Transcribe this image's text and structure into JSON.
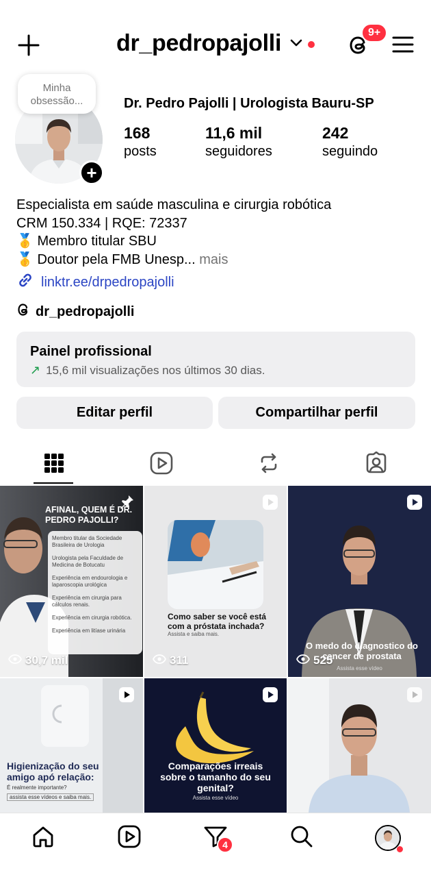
{
  "header": {
    "username": "dr_pedropajolli",
    "threads_badge": "9+"
  },
  "profile": {
    "note": "Minha obsessão...",
    "display_name": "Dr. Pedro Pajolli | Urologista Bauru-SP",
    "stats": [
      {
        "value": "168",
        "label": "posts"
      },
      {
        "value": "11,6 mil",
        "label": "seguidores"
      },
      {
        "value": "242",
        "label": "seguindo"
      }
    ],
    "bio": [
      "Especialista em saúde masculina e cirurgia robótica",
      "CRM 150.334 | RQE: 72337",
      "🥇 Membro titular SBU",
      "🥇 Doutor pela FMB Unesp..."
    ],
    "bio_more": "mais",
    "link": "linktr.ee/drpedropajolli",
    "threads_handle": "dr_pedropajolli"
  },
  "pro_panel": {
    "title": "Painel profissional",
    "subtitle": "15,6 mil visualizações nos últimos 30 dias."
  },
  "buttons": {
    "edit": "Editar perfil",
    "share": "Compartilhar perfil"
  },
  "tabs": [
    {
      "name": "posts-grid",
      "icon": "grid-icon",
      "active": true
    },
    {
      "name": "reels",
      "icon": "reels-icon",
      "active": false
    },
    {
      "name": "reposts",
      "icon": "repost-icon",
      "active": false
    },
    {
      "name": "tagged",
      "icon": "tagged-icon",
      "active": false
    }
  ],
  "posts": [
    {
      "type": "pinned",
      "views": "30,7 mil",
      "title": "AFINAL, QUEM É DR. PEDRO PAJOLLI?",
      "items": [
        "Membro titular da Sociedade Brasileira de Urologia",
        "Urologista pela Faculdade de Medicina de Botucatu",
        "Experiência em endourologia e laparoscopia urológica",
        "Experiência em cirurgia para cálculos renais.",
        "Experiência em cirurgia robótica.",
        "Experiência em litíase urinária"
      ]
    },
    {
      "type": "reel",
      "views": "311",
      "caption": "Como saber se você está com a próstata inchada?",
      "sub": "Assista e saiba mais."
    },
    {
      "type": "reel",
      "views": "525",
      "caption": "O medo do diagnostico do cancer de prostata",
      "sub": "Assista esse vídeo"
    },
    {
      "type": "reel",
      "caption": "Higienização do seu amigo apó relação:",
      "sub1": "É realmente importante?",
      "sub2": "assista esse vídeos e saiba mais."
    },
    {
      "type": "reel",
      "caption": "Comparações irreais sobre o tamanho do seu genital?",
      "sub": "Assista esse vídeo"
    },
    {
      "type": "reel"
    }
  ],
  "bottom_nav": {
    "activity_badge": "4"
  }
}
